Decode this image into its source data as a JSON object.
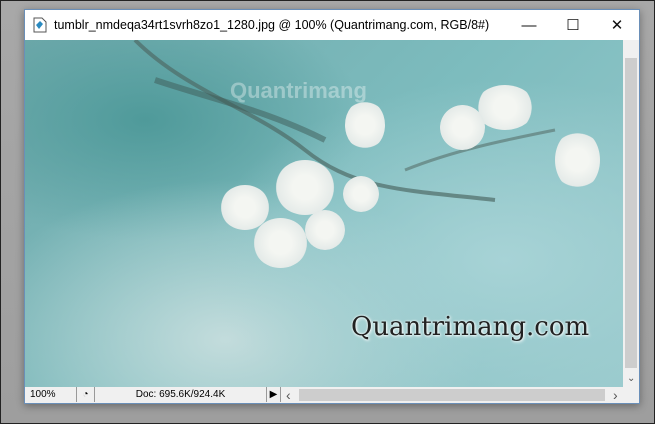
{
  "window": {
    "title": "tumblr_nmdeqa34rt1svrh8zo1_1280.jpg @ 100% (Quantrimang.com, RGB/8#)",
    "minimize": "—",
    "maximize": "☐",
    "close": "✕"
  },
  "image": {
    "watermark_top": "Quantrimang",
    "watermark_text": "Quantrimang.com"
  },
  "status": {
    "zoom": "100%",
    "doc": "Doc: 695.6K/924.4K",
    "menu_arrow": "▶"
  },
  "scroll": {
    "left": "‹",
    "right": "›",
    "down": "⌄"
  }
}
